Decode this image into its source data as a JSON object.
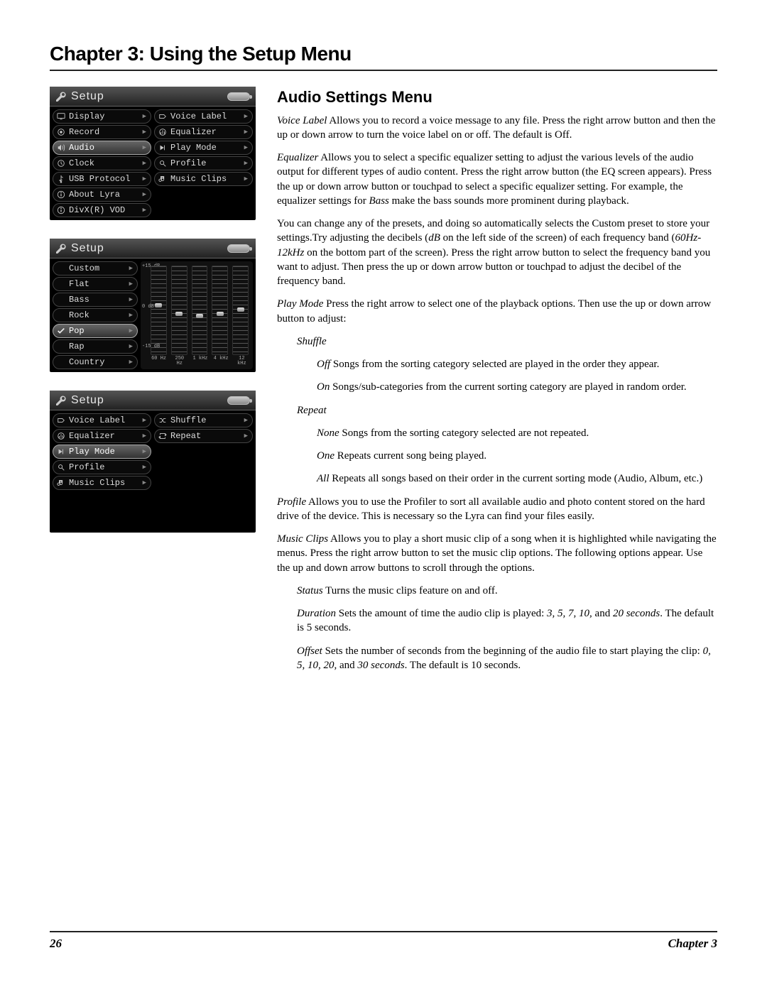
{
  "heading": "Chapter 3: Using the Setup Menu",
  "section_title": "Audio Settings Menu",
  "footer": {
    "page": "26",
    "chapter": "Chapter 3"
  },
  "device1": {
    "title": "Setup",
    "left_menu": [
      {
        "icon": "display-icon",
        "label": "Display"
      },
      {
        "icon": "record-icon",
        "label": "Record"
      },
      {
        "icon": "audio-icon",
        "label": "Audio",
        "selected": true
      },
      {
        "icon": "clock-icon",
        "label": "Clock"
      },
      {
        "icon": "usb-icon",
        "label": "USB Protocol"
      },
      {
        "icon": "info-icon",
        "label": "About Lyra"
      },
      {
        "icon": "info-icon",
        "label": "DivX(R) VOD"
      }
    ],
    "right_menu": [
      {
        "icon": "voice-label-icon",
        "label": "Voice Label"
      },
      {
        "icon": "equalizer-icon",
        "label": "Equalizer"
      },
      {
        "icon": "play-mode-icon",
        "label": "Play Mode"
      },
      {
        "icon": "profile-icon",
        "label": "Profile"
      },
      {
        "icon": "music-clips-icon",
        "label": "Music Clips"
      }
    ]
  },
  "device2": {
    "title": "Setup",
    "left_menu": [
      {
        "label": "Custom"
      },
      {
        "label": "Flat"
      },
      {
        "label": "Bass"
      },
      {
        "label": "Rock"
      },
      {
        "icon": "check-icon",
        "label": "Pop",
        "selected": true
      },
      {
        "label": "Rap"
      },
      {
        "label": "Country"
      }
    ],
    "eq": {
      "scale": [
        "+15 dB",
        "0 dB",
        "-15 dB"
      ],
      "freqs": [
        "60 Hz",
        "250 Hz",
        "1 kHz",
        "4 kHz",
        "12 kHz"
      ],
      "positions_pct": [
        42,
        52,
        54,
        52,
        47
      ]
    }
  },
  "device3": {
    "title": "Setup",
    "left_menu": [
      {
        "icon": "voice-label-icon",
        "label": "Voice Label"
      },
      {
        "icon": "equalizer-icon",
        "label": "Equalizer"
      },
      {
        "icon": "play-mode-icon",
        "label": "Play Mode",
        "selected": true
      },
      {
        "icon": "profile-icon",
        "label": "Profile"
      },
      {
        "icon": "music-clips-icon",
        "label": "Music Clips"
      }
    ],
    "right_menu": [
      {
        "icon": "shuffle-icon",
        "label": "Shuffle"
      },
      {
        "icon": "repeat-icon",
        "label": "Repeat"
      }
    ]
  },
  "body": {
    "voice_label": {
      "term": "Voice Label",
      "text": "   Allows you to record a voice message to any file. Press the right arrow button and then the up or down arrow to turn the voice label on or off. The default is Off."
    },
    "equalizer": {
      "term": "Equalizer",
      "text_a": "   Allows you to select a specific equalizer setting to adjust the various levels of the audio output for different types of audio content. Press the right arrow button (the EQ screen appears). Press the up or down arrow button or touchpad to select a specific equalizer setting. For example, the equalizer settings for ",
      "bass": "Bass",
      "text_b": " make the bass sounds more prominent during playback."
    },
    "presets": {
      "text_a": "You can change any of the presets, and doing so automatically selects the Custom preset to store your settings.Try adjusting the decibels (",
      "db": "dB",
      "text_b": " on the left side of the screen) of each frequency band (",
      "range": "60Hz-12kHz",
      "text_c": " on the bottom part of the screen). Press the right arrow button to select the frequency band you want to adjust. Then press the up or down arrow button or touchpad to adjust the decibel of the frequency band."
    },
    "play_mode": {
      "term": "Play Mode",
      "text": "   Press the right arrow to select one of the playback options. Then use the up or down arrow button to adjust:"
    },
    "shuffle": {
      "term": "Shuffle",
      "off_term": "Off",
      "off_text": "  Songs from the sorting category selected are played in the order they appear.",
      "on_term": "On",
      "on_text": "  Songs/sub-categories from the current sorting category are played in random order."
    },
    "repeat": {
      "term": "Repeat",
      "none_term": "None",
      "none_text": "  Songs from the sorting category selected are not repeated.",
      "one_term": "One",
      "one_text": "   Repeats current song being played.",
      "all_term": "All",
      "all_text": "   Repeats all songs based on their order in the current sorting mode (Audio, Album, etc.)"
    },
    "profile": {
      "term": "Profile",
      "text": "   Allows you to use the Profiler to sort all available audio and photo content stored on the hard drive of the device. This is necessary so the Lyra can find your files easily."
    },
    "music_clips": {
      "term": "Music Clips",
      "text": "   Allows you to play a short music clip of a song when it is highlighted while navigating the menus. Press the right arrow button to set the music clip options. The following options appear. Use the up and down arrow buttons to scroll through the options.",
      "status_term": "Status",
      "status_text": "   Turns the music clips feature on and off.",
      "duration_term": "Duration",
      "duration_text_a": "   Sets the amount of time the audio clip is played: ",
      "duration_vals": "3, 5, 7, 10,",
      "duration_and": " and ",
      "duration_last": "20 seconds",
      "duration_tail": ". The default is 5 seconds.",
      "offset_term": "Offset",
      "offset_text_a": "   Sets the number of seconds from the beginning of the audio file to start playing the clip: ",
      "offset_vals": "0, 5, 10, 20,",
      "offset_and": " and ",
      "offset_last": "30 seconds",
      "offset_tail": ". The default is 10 seconds."
    }
  }
}
